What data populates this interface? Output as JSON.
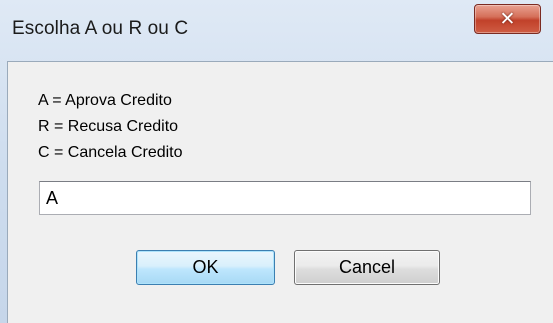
{
  "window": {
    "title": "Escolha A ou R ou C",
    "close_glyph": "✕"
  },
  "dialog": {
    "prompt_lines": [
      "A = Aprova Credito",
      "R = Recusa Credito",
      "C = Cancela Credito"
    ],
    "input_value": "A",
    "ok_label": "OK",
    "cancel_label": "Cancel"
  },
  "colors": {
    "title_bar": "#cddcee",
    "client_background": "#f0f0f0",
    "close_button": "#c1412a",
    "default_button_border": "#3c7fb1"
  },
  "icons": {
    "close": "close-icon"
  }
}
